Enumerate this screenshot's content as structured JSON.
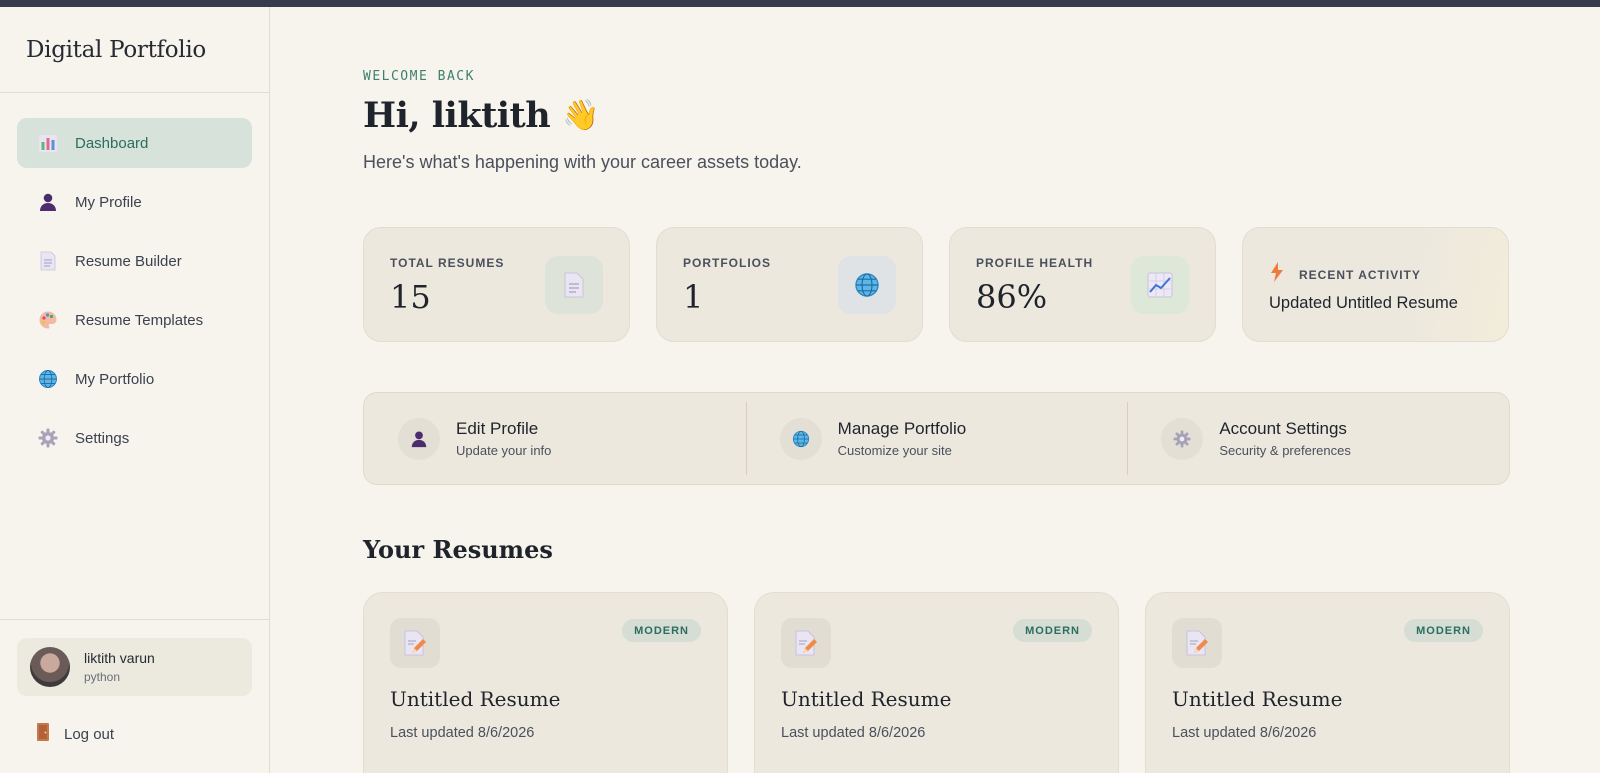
{
  "sidebar": {
    "brand": "Digital Portfolio",
    "items": [
      {
        "label": "Dashboard",
        "icon": "bar-chart-icon",
        "active": true
      },
      {
        "label": "My Profile",
        "icon": "user-icon",
        "active": false
      },
      {
        "label": "Resume Builder",
        "icon": "document-icon",
        "active": false
      },
      {
        "label": "Resume Templates",
        "icon": "palette-icon",
        "active": false
      },
      {
        "label": "My Portfolio",
        "icon": "globe-icon",
        "active": false
      },
      {
        "label": "Settings",
        "icon": "gear-icon",
        "active": false
      }
    ],
    "user": {
      "name": "liktith varun",
      "subtitle": "python"
    },
    "logout_label": "Log out"
  },
  "header": {
    "welcome": "WELCOME BACK",
    "greeting": "Hi, liktith",
    "wave": "👋",
    "subtitle": "Here's what's happening with your career assets today."
  },
  "stats": [
    {
      "label": "TOTAL RESUMES",
      "value": "15",
      "icon": "document-icon",
      "icon_bg": "#dde3d8"
    },
    {
      "label": "PORTFOLIOS",
      "value": "1",
      "icon": "globe-icon",
      "icon_bg": "#dfe3e6"
    },
    {
      "label": "PROFILE HEALTH",
      "value": "86%",
      "icon": "trend-chart-icon",
      "icon_bg": "#dde8d8"
    }
  ],
  "activity": {
    "label": "RECENT ACTIVITY",
    "text": "Updated Untitled Resume",
    "icon": "lightning-icon"
  },
  "quick_actions": [
    {
      "title": "Edit Profile",
      "subtitle": "Update your info",
      "icon": "user-icon"
    },
    {
      "title": "Manage Portfolio",
      "subtitle": "Customize your site",
      "icon": "globe-icon"
    },
    {
      "title": "Account Settings",
      "subtitle": "Security & preferences",
      "icon": "gear-icon"
    }
  ],
  "resumes_section": {
    "title": "Your Resumes",
    "items": [
      {
        "title": "Untitled Resume",
        "date": "Last updated 8/6/2026",
        "badge": "MODERN"
      },
      {
        "title": "Untitled Resume",
        "date": "Last updated 8/6/2026",
        "badge": "MODERN"
      },
      {
        "title": "Untitled Resume",
        "date": "Last updated 8/6/2026",
        "badge": "MODERN"
      }
    ]
  },
  "colors": {
    "accent": "#2b6e5e",
    "active_bg": "#d6e2da",
    "page_bg": "#f6f4ec",
    "card_bg": "#ece8de"
  }
}
